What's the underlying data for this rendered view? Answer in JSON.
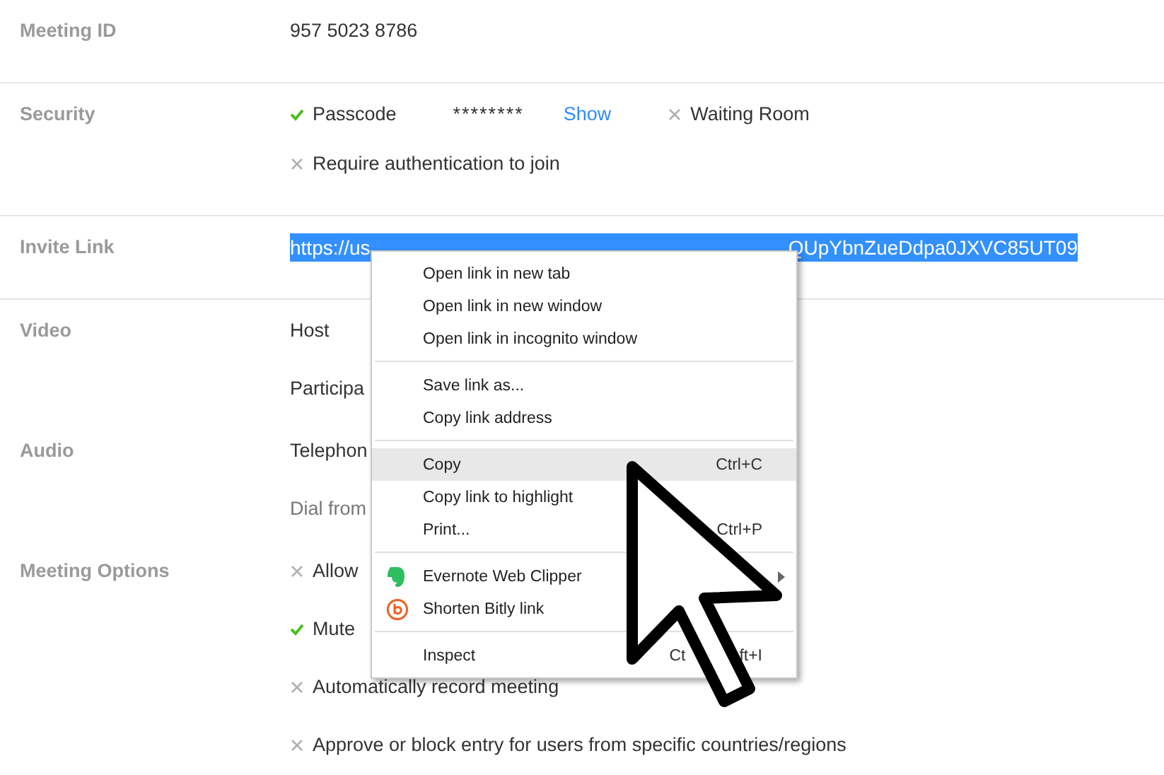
{
  "rows": [
    {
      "label": "Meeting ID",
      "divider": true,
      "lines": [
        [
          {
            "kind": "text",
            "text": "957 5023 8786"
          }
        ]
      ]
    },
    {
      "label": "Security",
      "divider": true,
      "lines": [
        [
          {
            "kind": "option",
            "text": "Passcode",
            "checked": true
          },
          {
            "kind": "secret",
            "text": "********"
          },
          {
            "kind": "link",
            "text": "Show"
          },
          {
            "kind": "option",
            "text": "Waiting Room",
            "checked": false
          }
        ],
        [
          {
            "kind": "option",
            "text": "Require authentication to join",
            "checked": false
          }
        ]
      ]
    },
    {
      "label": "Invite Link",
      "divider": true,
      "lines": [
        [
          {
            "kind": "selected-link",
            "text": "https://us",
            "text_end": "QUpYbnZueDdpa0JXVC85UT09"
          }
        ]
      ]
    },
    {
      "label": "Video",
      "divider": false,
      "lines": [
        [
          {
            "kind": "text",
            "text": "Host"
          }
        ],
        [
          {
            "kind": "text",
            "text": "Participa"
          }
        ]
      ]
    },
    {
      "label": "Audio",
      "divider": false,
      "lines": [
        [
          {
            "kind": "text",
            "text": "Telephon"
          }
        ],
        [
          {
            "kind": "note",
            "text": "Dial from"
          }
        ]
      ]
    },
    {
      "label": "Meeting Options",
      "divider": false,
      "lines": [
        [
          {
            "kind": "option",
            "text": "Allow",
            "checked": false
          }
        ],
        [
          {
            "kind": "option",
            "text": "Mute",
            "checked": true
          }
        ],
        [
          {
            "kind": "option",
            "text": "Automatically record meeting",
            "checked": false
          }
        ],
        [
          {
            "kind": "option",
            "text": "Approve or block entry for users from specific countries/regions",
            "checked": false
          }
        ]
      ]
    }
  ],
  "context_menu": {
    "groups": [
      [
        {
          "label": "Open link in new tab",
          "highlighted": false
        },
        {
          "label": "Open link in new window",
          "highlighted": false
        },
        {
          "label": "Open link in incognito window",
          "highlighted": false
        }
      ],
      [
        {
          "label": "Save link as...",
          "highlighted": false
        },
        {
          "label": "Copy link address",
          "highlighted": false
        }
      ],
      [
        {
          "label": "Copy",
          "shortcut": "Ctrl+C",
          "highlighted": true
        },
        {
          "label": "Copy link to highlight",
          "highlighted": false
        },
        {
          "label": "Print...",
          "shortcut": "Ctrl+P",
          "highlighted": false
        }
      ],
      [
        {
          "label": "Evernote Web Clipper",
          "kind": "evernote",
          "submenu": true,
          "highlighted": false
        },
        {
          "label": "Shorten Bitly link",
          "kind": "bitly",
          "highlighted": false
        }
      ],
      [
        {
          "label": "Inspect",
          "shortcut": "Ct",
          "shortcut_end": "ft+I",
          "highlighted": false
        }
      ]
    ]
  }
}
